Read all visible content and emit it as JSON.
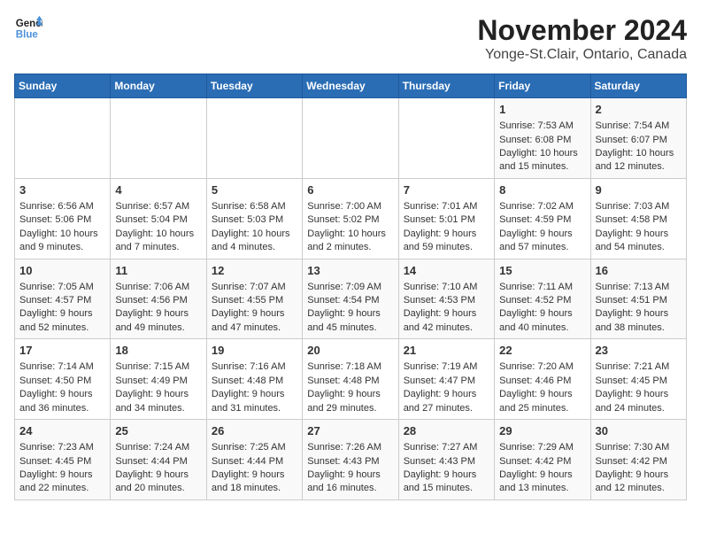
{
  "header": {
    "logo_line1": "General",
    "logo_line2": "Blue",
    "month_title": "November 2024",
    "location": "Yonge-St.Clair, Ontario, Canada"
  },
  "days_of_week": [
    "Sunday",
    "Monday",
    "Tuesday",
    "Wednesday",
    "Thursday",
    "Friday",
    "Saturday"
  ],
  "weeks": [
    [
      {
        "day": "",
        "info": ""
      },
      {
        "day": "",
        "info": ""
      },
      {
        "day": "",
        "info": ""
      },
      {
        "day": "",
        "info": ""
      },
      {
        "day": "",
        "info": ""
      },
      {
        "day": "1",
        "info": "Sunrise: 7:53 AM\nSunset: 6:08 PM\nDaylight: 10 hours and 15 minutes."
      },
      {
        "day": "2",
        "info": "Sunrise: 7:54 AM\nSunset: 6:07 PM\nDaylight: 10 hours and 12 minutes."
      }
    ],
    [
      {
        "day": "3",
        "info": "Sunrise: 6:56 AM\nSunset: 5:06 PM\nDaylight: 10 hours and 9 minutes."
      },
      {
        "day": "4",
        "info": "Sunrise: 6:57 AM\nSunset: 5:04 PM\nDaylight: 10 hours and 7 minutes."
      },
      {
        "day": "5",
        "info": "Sunrise: 6:58 AM\nSunset: 5:03 PM\nDaylight: 10 hours and 4 minutes."
      },
      {
        "day": "6",
        "info": "Sunrise: 7:00 AM\nSunset: 5:02 PM\nDaylight: 10 hours and 2 minutes."
      },
      {
        "day": "7",
        "info": "Sunrise: 7:01 AM\nSunset: 5:01 PM\nDaylight: 9 hours and 59 minutes."
      },
      {
        "day": "8",
        "info": "Sunrise: 7:02 AM\nSunset: 4:59 PM\nDaylight: 9 hours and 57 minutes."
      },
      {
        "day": "9",
        "info": "Sunrise: 7:03 AM\nSunset: 4:58 PM\nDaylight: 9 hours and 54 minutes."
      }
    ],
    [
      {
        "day": "10",
        "info": "Sunrise: 7:05 AM\nSunset: 4:57 PM\nDaylight: 9 hours and 52 minutes."
      },
      {
        "day": "11",
        "info": "Sunrise: 7:06 AM\nSunset: 4:56 PM\nDaylight: 9 hours and 49 minutes."
      },
      {
        "day": "12",
        "info": "Sunrise: 7:07 AM\nSunset: 4:55 PM\nDaylight: 9 hours and 47 minutes."
      },
      {
        "day": "13",
        "info": "Sunrise: 7:09 AM\nSunset: 4:54 PM\nDaylight: 9 hours and 45 minutes."
      },
      {
        "day": "14",
        "info": "Sunrise: 7:10 AM\nSunset: 4:53 PM\nDaylight: 9 hours and 42 minutes."
      },
      {
        "day": "15",
        "info": "Sunrise: 7:11 AM\nSunset: 4:52 PM\nDaylight: 9 hours and 40 minutes."
      },
      {
        "day": "16",
        "info": "Sunrise: 7:13 AM\nSunset: 4:51 PM\nDaylight: 9 hours and 38 minutes."
      }
    ],
    [
      {
        "day": "17",
        "info": "Sunrise: 7:14 AM\nSunset: 4:50 PM\nDaylight: 9 hours and 36 minutes."
      },
      {
        "day": "18",
        "info": "Sunrise: 7:15 AM\nSunset: 4:49 PM\nDaylight: 9 hours and 34 minutes."
      },
      {
        "day": "19",
        "info": "Sunrise: 7:16 AM\nSunset: 4:48 PM\nDaylight: 9 hours and 31 minutes."
      },
      {
        "day": "20",
        "info": "Sunrise: 7:18 AM\nSunset: 4:48 PM\nDaylight: 9 hours and 29 minutes."
      },
      {
        "day": "21",
        "info": "Sunrise: 7:19 AM\nSunset: 4:47 PM\nDaylight: 9 hours and 27 minutes."
      },
      {
        "day": "22",
        "info": "Sunrise: 7:20 AM\nSunset: 4:46 PM\nDaylight: 9 hours and 25 minutes."
      },
      {
        "day": "23",
        "info": "Sunrise: 7:21 AM\nSunset: 4:45 PM\nDaylight: 9 hours and 24 minutes."
      }
    ],
    [
      {
        "day": "24",
        "info": "Sunrise: 7:23 AM\nSunset: 4:45 PM\nDaylight: 9 hours and 22 minutes."
      },
      {
        "day": "25",
        "info": "Sunrise: 7:24 AM\nSunset: 4:44 PM\nDaylight: 9 hours and 20 minutes."
      },
      {
        "day": "26",
        "info": "Sunrise: 7:25 AM\nSunset: 4:44 PM\nDaylight: 9 hours and 18 minutes."
      },
      {
        "day": "27",
        "info": "Sunrise: 7:26 AM\nSunset: 4:43 PM\nDaylight: 9 hours and 16 minutes."
      },
      {
        "day": "28",
        "info": "Sunrise: 7:27 AM\nSunset: 4:43 PM\nDaylight: 9 hours and 15 minutes."
      },
      {
        "day": "29",
        "info": "Sunrise: 7:29 AM\nSunset: 4:42 PM\nDaylight: 9 hours and 13 minutes."
      },
      {
        "day": "30",
        "info": "Sunrise: 7:30 AM\nSunset: 4:42 PM\nDaylight: 9 hours and 12 minutes."
      }
    ]
  ]
}
